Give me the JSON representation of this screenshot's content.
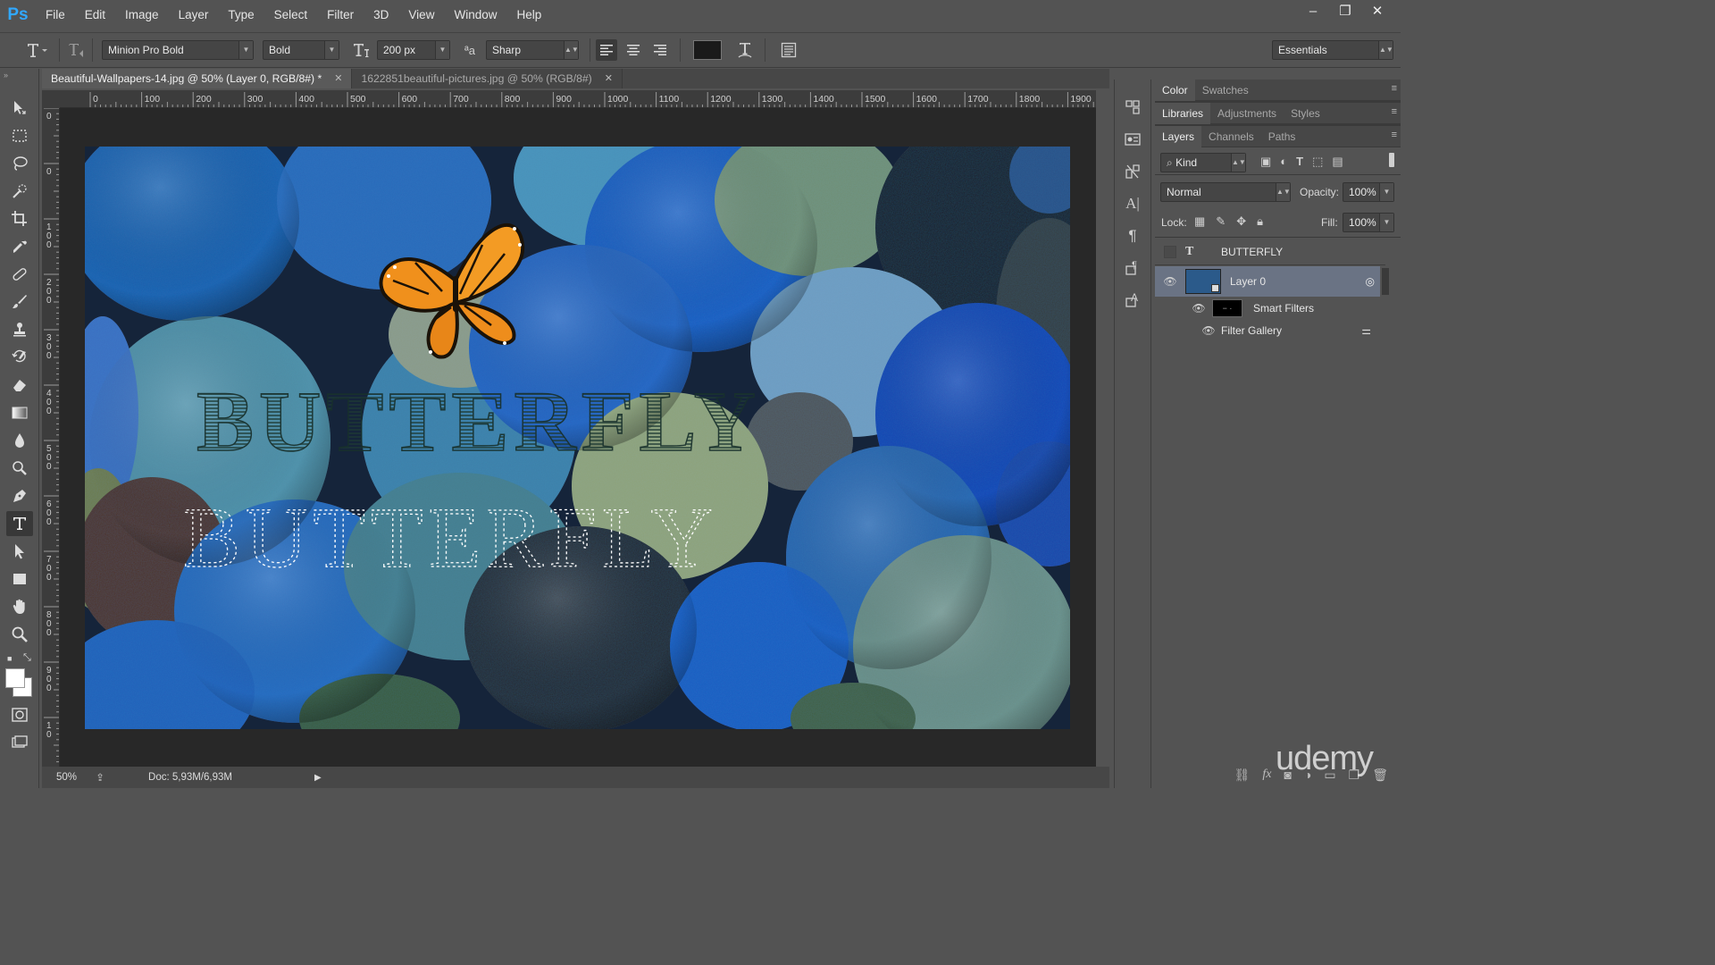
{
  "app": {
    "logo": "Ps"
  },
  "menu": [
    "File",
    "Edit",
    "Image",
    "Layer",
    "Type",
    "Select",
    "Filter",
    "3D",
    "View",
    "Window",
    "Help"
  ],
  "window_controls": {
    "minimize": "–",
    "restore": "❐",
    "close": "✕"
  },
  "options": {
    "font_family": "Minion Pro Bold",
    "font_style": "Bold",
    "font_size": "200 px",
    "antialias": "Sharp",
    "aa_label": "ªa",
    "workspace": "Essentials"
  },
  "tabs": [
    {
      "label": "Beautiful-Wallpapers-14.jpg @ 50% (Layer 0, RGB/8#) *",
      "close": "✕"
    },
    {
      "label": "1622851beautiful-pictures.jpg @ 50% (RGB/8#)",
      "close": "✕"
    }
  ],
  "ruler": {
    "h_ticks": [
      "0",
      "100",
      "200",
      "300",
      "400",
      "500",
      "600",
      "700",
      "800",
      "900",
      "1000",
      "1100",
      "1200",
      "1300",
      "1400",
      "1500",
      "1600",
      "1700",
      "1800",
      "1900"
    ],
    "v_ticks": [
      "0",
      "0",
      "1 0 0",
      "2 0 0",
      "3 0 0",
      "4 0 0",
      "5 0 0",
      "6 0 0",
      "7 0 0",
      "8 0 0",
      "9 0 0",
      "1 0"
    ]
  },
  "canvas_text": {
    "line1": "BUTTERFLY",
    "line2": "BUTTERFLY"
  },
  "status": {
    "zoom": "50%",
    "doc": "Doc: 5,93M/6,93M"
  },
  "panels": {
    "color_tabs": [
      "Color",
      "Swatches"
    ],
    "lib_tabs": [
      "Libraries",
      "Adjustments",
      "Styles"
    ],
    "layer_tabs": [
      "Layers",
      "Channels",
      "Paths"
    ],
    "kind_label": "Kind",
    "blend_mode": "Normal",
    "opacity_label": "Opacity:",
    "opacity_value": "100%",
    "lock_label": "Lock:",
    "fill_label": "Fill:",
    "fill_value": "100%",
    "layers": [
      {
        "name": "BUTTERFLY",
        "type": "text"
      },
      {
        "name": "Layer 0",
        "type": "smart"
      },
      {
        "name": "Smart Filters",
        "type": "filters"
      },
      {
        "name": "Filter Gallery",
        "type": "filter"
      }
    ],
    "bottom_icons": [
      "link-icon",
      "fx-icon",
      "mask-icon",
      "adjustment-icon",
      "folder-icon",
      "new-layer-icon",
      "trash-icon"
    ]
  },
  "watermark": "udemy",
  "colors": {
    "accent": "#31a8ff",
    "monarch": "#f0901c",
    "bg": "#535353"
  }
}
